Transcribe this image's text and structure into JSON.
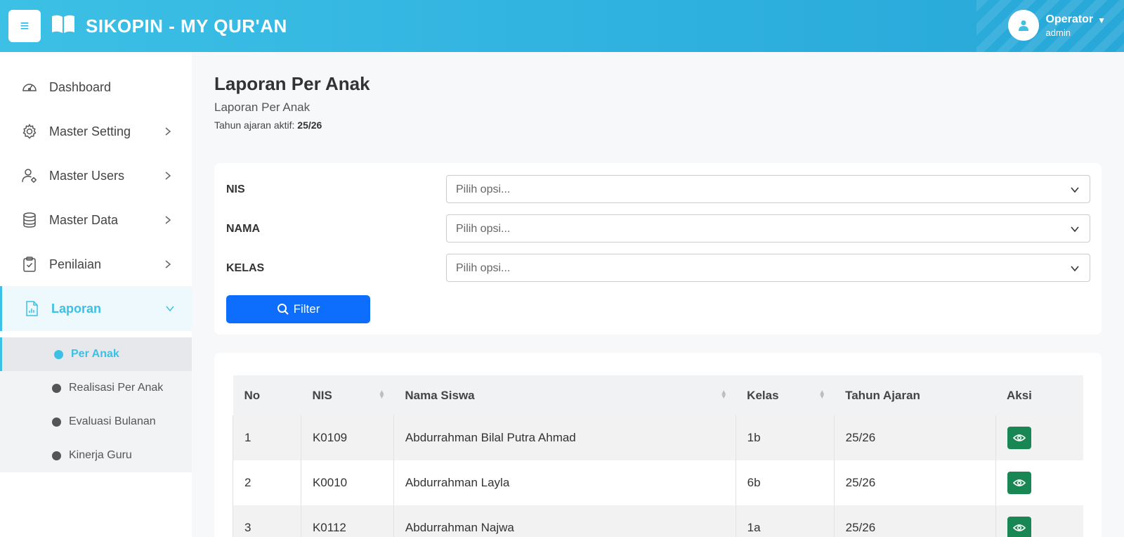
{
  "header": {
    "brand_title": "SIKOPIN - MY QUR'AN",
    "menu_icon": "hamburger-icon",
    "brand_icon": "book-icon",
    "user": {
      "name": "Operator",
      "role": "admin"
    }
  },
  "colors": {
    "primary": "#3cc0e5",
    "filter_button": "#0d6efd",
    "view_button": "#198754"
  },
  "sidebar": {
    "items": [
      {
        "label": "Dashboard",
        "icon": "speedometer-icon"
      },
      {
        "label": "Master Setting",
        "icon": "gear-icon"
      },
      {
        "label": "Master Users",
        "icon": "user-gear-icon"
      },
      {
        "label": "Master Data",
        "icon": "database-icon"
      },
      {
        "label": "Penilaian",
        "icon": "clipboard-check-icon"
      },
      {
        "label": "Laporan",
        "icon": "report-chart-icon",
        "active": true
      }
    ],
    "sub_items": [
      {
        "label": "Per Anak",
        "active": true
      },
      {
        "label": "Realisasi Per Anak"
      },
      {
        "label": "Evaluasi Bulanan"
      },
      {
        "label": "Kinerja Guru"
      }
    ]
  },
  "page": {
    "title": "Laporan Per Anak",
    "subtitle": "Laporan Per Anak",
    "year_label": "Tahun ajaran aktif:",
    "year_value": "25/26"
  },
  "filter": {
    "fields": [
      {
        "label": "NIS",
        "placeholder": "Pilih opsi..."
      },
      {
        "label": "NAMA",
        "placeholder": "Pilih opsi..."
      },
      {
        "label": "KELAS",
        "placeholder": "Pilih opsi..."
      }
    ],
    "button_label": "Filter"
  },
  "table": {
    "headers": [
      "No",
      "NIS",
      "Nama Siswa",
      "Kelas",
      "Tahun Ajaran",
      "Aksi"
    ],
    "rows": [
      {
        "no": "1",
        "nis": "K0109",
        "nama": "Abdurrahman Bilal Putra Ahmad",
        "kelas": "1b",
        "tahun": "25/26"
      },
      {
        "no": "2",
        "nis": "K0010",
        "nama": "Abdurrahman Layla",
        "kelas": "6b",
        "tahun": "25/26"
      },
      {
        "no": "3",
        "nis": "K0112",
        "nama": "Abdurrahman Najwa",
        "kelas": "1a",
        "tahun": "25/26"
      }
    ]
  }
}
